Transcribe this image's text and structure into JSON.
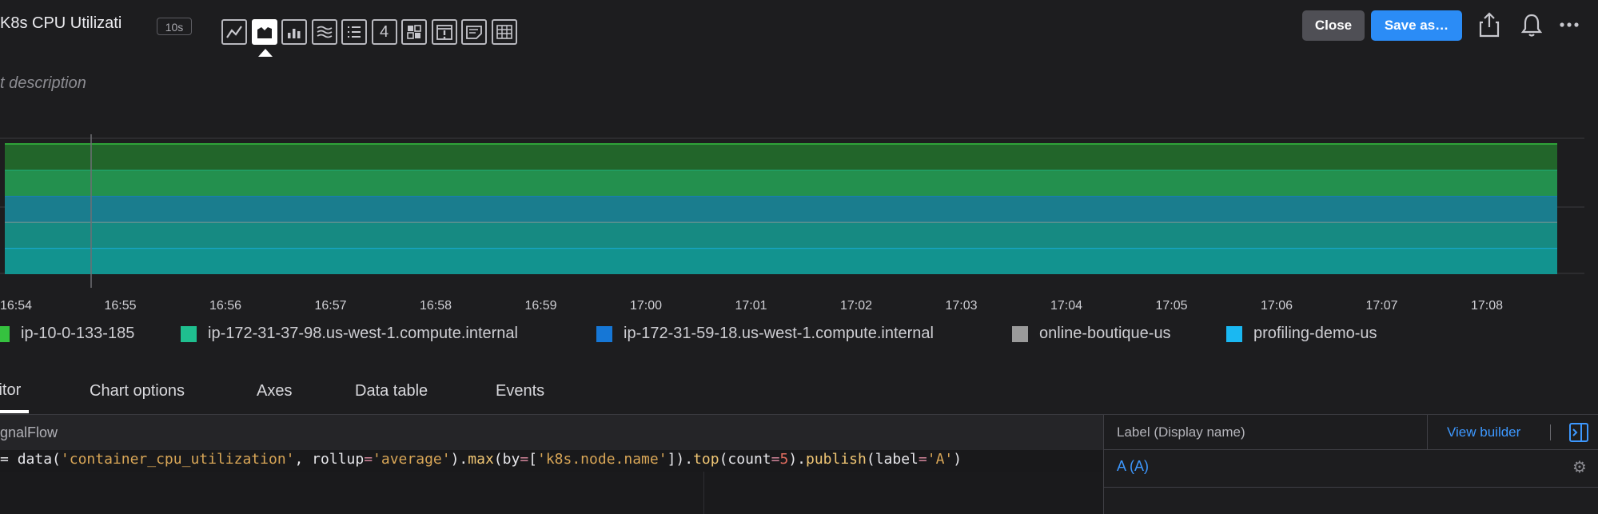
{
  "header": {
    "title": "K8s CPU Utilizati",
    "resolution": "10s",
    "description_placeholder": "t description",
    "close_label": "Close",
    "save_label": "Save as…",
    "chart_types": [
      {
        "name": "line-chart-icon",
        "active": false
      },
      {
        "name": "area-chart-icon",
        "active": true
      },
      {
        "name": "column-chart-icon",
        "active": false
      },
      {
        "name": "histogram-icon",
        "active": false
      },
      {
        "name": "list-chart-icon",
        "active": false
      },
      {
        "name": "single-value-icon",
        "label": "4",
        "active": false
      },
      {
        "name": "heatmap-icon",
        "active": false
      },
      {
        "name": "event-feed-icon",
        "active": false
      },
      {
        "name": "text-note-icon",
        "active": false
      },
      {
        "name": "table-chart-icon",
        "active": false
      }
    ],
    "icons": [
      "share-icon",
      "bell-icon",
      "more-icon"
    ]
  },
  "chart_data": {
    "type": "area",
    "stacked": true,
    "x": [
      "16:54",
      "16:55",
      "16:56",
      "16:57",
      "16:58",
      "16:59",
      "17:00",
      "17:01",
      "17:02",
      "17:03",
      "17:04",
      "17:05",
      "17:06",
      "17:07",
      "17:08"
    ],
    "series": [
      {
        "name": "ip-10-0-133-185",
        "color": "#35c23f",
        "values": [
          1,
          1,
          1,
          1,
          1,
          1,
          1,
          1,
          1,
          1,
          1,
          1,
          1,
          1,
          1
        ]
      },
      {
        "name": "ip-172-31-37-98.us-west-1.compute.internal",
        "color": "#1fbf8f",
        "values": [
          1,
          1,
          1,
          1,
          1,
          1,
          1,
          1,
          1,
          1,
          1,
          1,
          1,
          1,
          1
        ]
      },
      {
        "name": "ip-172-31-59-18.us-west-1.compute.internal",
        "color": "#1677d6",
        "values": [
          1,
          1,
          1,
          1,
          1,
          1,
          1,
          1,
          1,
          1,
          1,
          1,
          1,
          1,
          1
        ]
      },
      {
        "name": "online-boutique-us",
        "color": "#9a9a9a",
        "values": [
          1,
          1,
          1,
          1,
          1,
          1,
          1,
          1,
          1,
          1,
          1,
          1,
          1,
          1,
          1
        ]
      },
      {
        "name": "profiling-demo-us",
        "color": "#1ab8f2",
        "values": [
          1,
          1,
          1,
          1,
          1,
          1,
          1,
          1,
          1,
          1,
          1,
          1,
          1,
          1,
          1
        ]
      }
    ],
    "grid": true,
    "legend": "bottom"
  },
  "tabs": [
    {
      "label": "litor",
      "active": true
    },
    {
      "label": "Chart options",
      "active": false
    },
    {
      "label": "Axes",
      "active": false
    },
    {
      "label": "Data table",
      "active": false
    },
    {
      "label": "Events",
      "active": false
    }
  ],
  "editor": {
    "header": "gnalFlow",
    "code_tokens": [
      {
        "t": "= ",
        "c": "kw"
      },
      {
        "t": "data",
        "c": "kw"
      },
      {
        "t": "(",
        "c": "kw"
      },
      {
        "t": "'container_cpu_utilization'",
        "c": "str"
      },
      {
        "t": ", rollup",
        "c": "kw"
      },
      {
        "t": "=",
        "c": "op"
      },
      {
        "t": "'average'",
        "c": "str"
      },
      {
        "t": ").",
        "c": "kw"
      },
      {
        "t": "max",
        "c": "fn"
      },
      {
        "t": "(by",
        "c": "kw"
      },
      {
        "t": "=",
        "c": "op"
      },
      {
        "t": "[",
        "c": "kw"
      },
      {
        "t": "'k8s.node.name'",
        "c": "str"
      },
      {
        "t": "]).",
        "c": "kw"
      },
      {
        "t": "top",
        "c": "fn"
      },
      {
        "t": "(count",
        "c": "kw"
      },
      {
        "t": "=",
        "c": "op"
      },
      {
        "t": "5",
        "c": "num"
      },
      {
        "t": ").",
        "c": "kw"
      },
      {
        "t": "publish",
        "c": "fn"
      },
      {
        "t": "(label",
        "c": "kw"
      },
      {
        "t": "=",
        "c": "op"
      },
      {
        "t": "'A'",
        "c": "str"
      },
      {
        "t": ")",
        "c": "kw"
      }
    ]
  },
  "label_panel": {
    "header": "Label (Display name)",
    "view_builder": "View builder",
    "value": "A (A)"
  }
}
